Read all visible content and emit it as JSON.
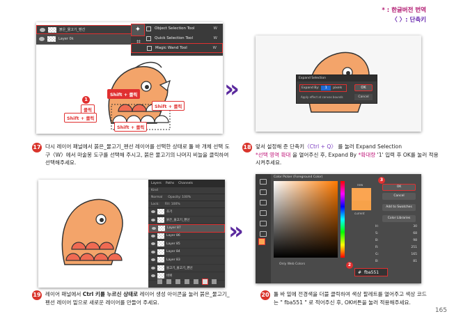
{
  "legend": {
    "line1": "* : 한글버전 번역",
    "line2": "〈 〉: 단축키"
  },
  "card1": {
    "layers": [
      {
        "label": "붉은_물고기_펜선",
        "selected": true
      },
      {
        "label": "Layer 0k",
        "selected": false
      }
    ],
    "tool_menu": [
      {
        "label": "Object Selection Tool",
        "key": "W",
        "selected": false
      },
      {
        "label": "Quick Selection Tool",
        "key": "W",
        "selected": false
      },
      {
        "label": "Magic Wand Tool",
        "key": "W",
        "selected": true
      }
    ],
    "callouts": {
      "c1": "Shift + 클릭",
      "c2": "Shift + 클릭",
      "c3": "클릭",
      "c4": "Shift + 클릭",
      "c5": "Shift + 클릭",
      "badge": "1"
    }
  },
  "card2": {
    "dialog_title": "Expand Selection",
    "expand_by_label": "Expand By:",
    "expand_by_value": "1",
    "unit": "pixels",
    "apply_label": "Apply effect at canvas bounds",
    "ok": "OK",
    "cancel": "Cancel"
  },
  "card3": {
    "tabs": [
      "Layers",
      "Paths",
      "Channels"
    ],
    "kind": "Kind",
    "blend": "Normal",
    "opacity": "Opacity: 100%",
    "lock": "Lock:",
    "fill": "Fill: 100%",
    "layers": [
      {
        "label": "초기",
        "selected": false
      },
      {
        "label": "붉은_물고기_펜선",
        "selected": false
      },
      {
        "label": "Layer 87",
        "selected": true
      },
      {
        "label": "Layer 86",
        "selected": false
      },
      {
        "label": "Layer 85",
        "selected": false
      },
      {
        "label": "Layer 84",
        "selected": false
      },
      {
        "label": "Layer 83",
        "selected": false
      },
      {
        "label": "물고기_물고기_펜선",
        "selected": false
      },
      {
        "label": "바위",
        "selected": false
      }
    ]
  },
  "card4": {
    "title": "Color Picker (Foreground Color)",
    "new_label": "new",
    "current_label": "current",
    "ok": "OK",
    "cancel": "Cancel",
    "add_to_swatches": "Add to Swatches",
    "color_libraries": "Color Libraries",
    "only_web_colors": "Only Web Colors",
    "hex_prefix": "#",
    "hex_value": "fba551",
    "values": [
      {
        "k": "H:",
        "v": "30"
      },
      {
        "k": "S:",
        "v": "68"
      },
      {
        "k": "B:",
        "v": "98"
      },
      {
        "k": "R:",
        "v": "251"
      },
      {
        "k": "G:",
        "v": "165"
      },
      {
        "k": "B:",
        "v": "81"
      }
    ],
    "badge_ok": "3",
    "badge_hex": "2",
    "fg_color": "#fba551"
  },
  "steps": {
    "s17": {
      "num": "17",
      "text": "다시 레이어 패널에서 붉은_물고기_펜선 레이어를 선택한 상태로 툴 바 개체 선택 도구〈W〉에서 마술봉 도구를 선택해 주시고, 붉은 물고기의 나머지 비늘을 클릭하여 선택해주세요."
    },
    "s18": {
      "num": "18",
      "a": "앞서 설정해 준 단축키",
      "b": "〈Ctrl + Q〉",
      "c": " 를 눌러 Expand Selection",
      "d": "*선택 영역 확대",
      "e": " 을 열어주신 후, Expand By ",
      "f": "*확대량",
      "g": " '1' 입력 후 OK를 눌러 적용시켜주세요."
    },
    "s19": {
      "num": "19",
      "a": "레이어 패널에서 ",
      "b": "Ctrl 키를 누르신 상태로",
      "c": " 레이어 생성 아이콘을 눌러 붉은_물고기_펜선 레이어 밑으로 새로운 레이어를 만들어 주세요."
    },
    "s20": {
      "num": "20",
      "text": "툴 바 밑에 전경색을 더블 클릭하여 색상 팔레트를 열어주고 색상 코드는 \" fba551 \" 로 적어주신 후, OK버튼을 눌러 적용해주세요."
    }
  },
  "page_number": "165",
  "colors": {
    "accent_red": "#e03030",
    "arrow_purple": "#5b2a9e",
    "step_badge": "#d9342b"
  }
}
